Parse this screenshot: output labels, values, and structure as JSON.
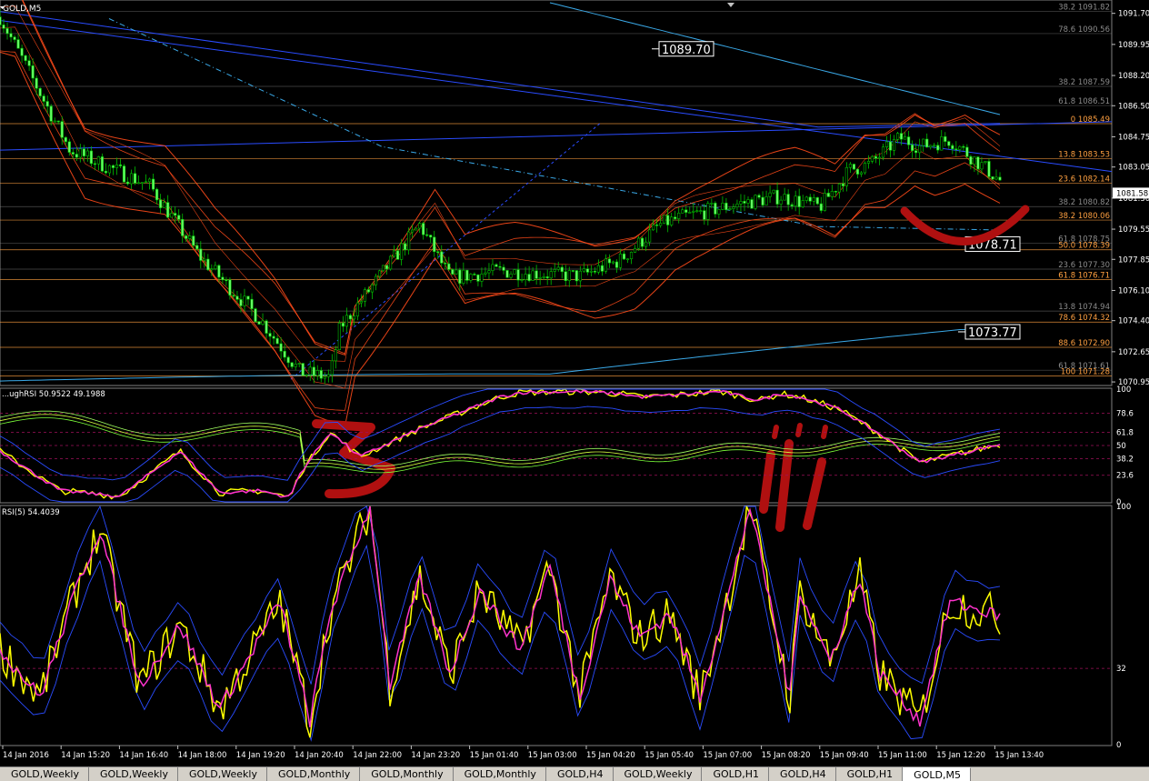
{
  "window": {
    "symbol_label": "GOLD,M5"
  },
  "colors": {
    "background": "#000000",
    "candle_up": "#00c000",
    "candle_down": "#66ff66",
    "grid": "#2a2a2a",
    "fib_orange": "#ffa040",
    "fib_gray": "#8c8c8c",
    "bollinger_red": "#ff4a1a",
    "trend_blue": "#2a4cff",
    "cyan": "#3aa9e8",
    "rsi_yellow": "#ffff00",
    "rsi_magenta": "#ff33cc",
    "annotation_red": "#b01010"
  },
  "chart_data": [
    {
      "type": "line",
      "panel": "price",
      "series_label": "GOLD,M5",
      "y_ticks": [
        "1091.70",
        "1089.95",
        "1088.20",
        "1086.50",
        "1084.75",
        "1083.05",
        "1081.30",
        "1079.55",
        "1077.85",
        "1076.10",
        "1074.40",
        "1072.65",
        "1070.95"
      ],
      "ylim": [
        1070.8,
        1092.4
      ],
      "current_price_label": "1081.58",
      "price_labels": [
        "1089.70",
        "1078.71",
        "1073.77"
      ],
      "fib_levels": [
        {
          "label": "38.2 1091.82",
          "value": 1091.82,
          "color": "gray"
        },
        {
          "label": "78.6 1090.56",
          "value": 1090.56,
          "color": "gray"
        },
        {
          "label": "38.2 1087.59",
          "value": 1087.59,
          "color": "gray"
        },
        {
          "label": "61.8 1086.51",
          "value": 1086.51,
          "color": "gray"
        },
        {
          "label": "0 1085.49",
          "value": 1085.49,
          "color": "orange"
        },
        {
          "label": "13.8 1083.53",
          "value": 1083.53,
          "color": "orange"
        },
        {
          "label": "23.6 1082.14",
          "value": 1082.14,
          "color": "orange"
        },
        {
          "label": "38.2 1080.82",
          "value": 1080.82,
          "color": "gray"
        },
        {
          "label": "38.2 1080.06",
          "value": 1080.06,
          "color": "orange"
        },
        {
          "label": "61.8 1078.75",
          "value": 1078.75,
          "color": "gray"
        },
        {
          "label": "50.0 1078.39",
          "value": 1078.39,
          "color": "orange"
        },
        {
          "label": "23.6 1077.30",
          "value": 1077.3,
          "color": "gray"
        },
        {
          "label": "61.8 1076.71",
          "value": 1076.71,
          "color": "orange"
        },
        {
          "label": "13.8 1074.94",
          "value": 1074.94,
          "color": "gray"
        },
        {
          "label": "78.6 1074.32",
          "value": 1074.32,
          "color": "orange"
        },
        {
          "label": "88.6 1072.90",
          "value": 1072.9,
          "color": "orange"
        },
        {
          "label": "61.8 1071.61",
          "value": 1071.61,
          "color": "gray"
        },
        {
          "label": "100 1071.28",
          "value": 1071.28,
          "color": "orange"
        }
      ],
      "close_anchor": {
        "x": [
          0,
          0.07,
          0.15,
          0.2,
          0.26,
          0.3,
          0.33,
          0.34,
          0.42,
          0.45,
          0.5,
          0.58,
          0.62,
          0.66,
          0.68,
          0.74,
          0.78,
          0.82,
          0.85,
          0.87,
          0.9,
          0.92,
          0.95,
          1
        ],
        "y": [
          1091.5,
          1084.0,
          1082.0,
          1078.0,
          1074.5,
          1071.5,
          1071.2,
          1074.0,
          1079.8,
          1076.8,
          1077.2,
          1076.9,
          1077.8,
          1079.8,
          1080.2,
          1081.0,
          1081.4,
          1080.8,
          1082.9,
          1083.2,
          1084.7,
          1084.2,
          1084.6,
          1082.3
        ]
      }
    },
    {
      "type": "line",
      "panel": "indicator_1",
      "title": "...ughRSI 50.9522 49.1988",
      "y_ticks": [
        "100",
        "78.6",
        "61.8",
        "50",
        "38.2",
        "23.6",
        "0"
      ],
      "ylim": [
        0,
        100
      ],
      "levels": [
        78.6,
        61.8,
        50,
        38.2,
        23.6
      ],
      "series": [
        {
          "name": "RSI",
          "color": "#ff33cc",
          "x": [
            0,
            0.06,
            0.12,
            0.18,
            0.22,
            0.26,
            0.29,
            0.3,
            0.33,
            0.36,
            0.42,
            0.5,
            0.52,
            0.58,
            0.62,
            0.64,
            0.68,
            0.72,
            0.76,
            0.78,
            0.8,
            0.84,
            0.88,
            0.92,
            1
          ],
          "y": [
            45,
            10,
            5,
            45,
            8,
            10,
            4,
            25,
            62,
            40,
            65,
            93,
            97,
            98,
            96,
            93,
            95,
            98,
            90,
            96,
            93,
            82,
            60,
            35,
            51
          ]
        }
      ]
    },
    {
      "type": "line",
      "panel": "indicator_2",
      "title": "RSI(5) 54.4039",
      "y_ticks": [
        "100",
        "32",
        "0"
      ],
      "ylim": [
        0,
        100
      ],
      "level": 32,
      "series": [
        {
          "name": "RSI(5)",
          "color": "#ffff00",
          "x": [
            0,
            0.04,
            0.08,
            0.1,
            0.14,
            0.18,
            0.22,
            0.26,
            0.28,
            0.31,
            0.33,
            0.37,
            0.39,
            0.42,
            0.45,
            0.48,
            0.52,
            0.55,
            0.58,
            0.61,
            0.64,
            0.67,
            0.7,
            0.73,
            0.75,
            0.79,
            0.8,
            0.83,
            0.86,
            0.88,
            0.92,
            0.95,
            1
          ],
          "y": [
            40,
            20,
            70,
            90,
            25,
            50,
            15,
            45,
            60,
            10,
            55,
            100,
            25,
            70,
            30,
            65,
            40,
            75,
            20,
            70,
            45,
            55,
            20,
            65,
            100,
            20,
            65,
            35,
            70,
            30,
            10,
            60,
            54
          ]
        }
      ]
    }
  ],
  "x_axis_labels": [
    "14 Jan 2016",
    "14 Jan 15:20",
    "14 Jan 16:40",
    "14 Jan 18:00",
    "14 Jan 19:20",
    "14 Jan 20:40",
    "14 Jan 22:00",
    "14 Jan 23:20",
    "15 Jan 01:40",
    "15 Jan 03:00",
    "15 Jan 04:20",
    "15 Jan 05:40",
    "15 Jan 07:00",
    "15 Jan 08:20",
    "15 Jan 09:40",
    "15 Jan 11:00",
    "15 Jan 12:20",
    "15 Jan 13:40"
  ],
  "tabs": [
    "GOLD,Weekly",
    "GOLD,Weekly",
    "GOLD,Weekly",
    "GOLD,Monthly",
    "GOLD,Monthly",
    "GOLD,Monthly",
    "GOLD,H4",
    "GOLD,Weekly",
    "GOLD,H1",
    "GOLD,H4",
    "GOLD,H1",
    "GOLD,M5"
  ],
  "active_tab_index": 11
}
